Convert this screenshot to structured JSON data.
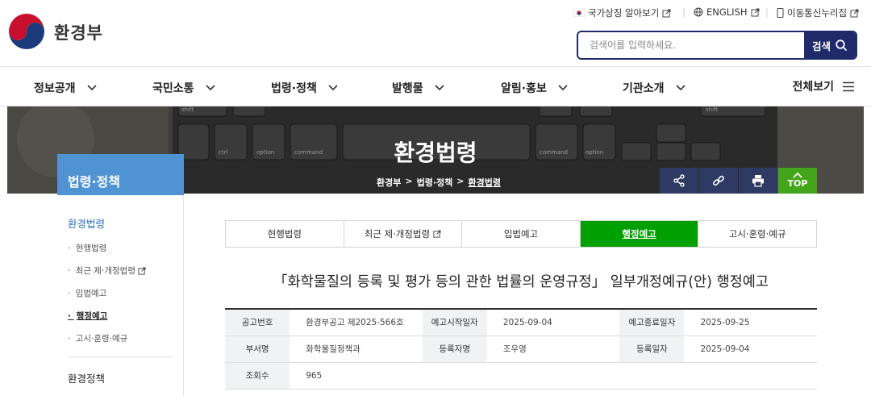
{
  "header": {
    "logo_text": "환경부",
    "util_links": [
      {
        "label": "국가상징 알아보기"
      },
      {
        "label": "ENGLISH"
      },
      {
        "label": "이동통신누리집"
      }
    ],
    "search": {
      "placeholder": "검색어를 입력하세요.",
      "button_label": "검색"
    }
  },
  "gnb": {
    "items": [
      "정보공개",
      "국민소통",
      "법령·정책",
      "발행물",
      "알림·홍보",
      "기관소개"
    ],
    "all_label": "전체보기"
  },
  "visual": {
    "title": "환경법령",
    "breadcrumb": [
      "환경부",
      "법령·정책",
      "환경법령"
    ],
    "breadcrumb_sep": ">",
    "top_label": "TOP"
  },
  "lnb": {
    "title": "법령·정책",
    "categories": [
      {
        "label": "환경법령",
        "active": true
      },
      {
        "label": "환경정책",
        "active": false
      }
    ],
    "sub_items": [
      "현행법령",
      "최근 제·개정법령",
      "입법예고",
      "행정예고",
      "고시·훈령·예규"
    ]
  },
  "tabs": [
    "현행법령",
    "최근 제·개정법령",
    "입법예고",
    "행정예고",
    "고시·훈령·예규"
  ],
  "document": {
    "title": "「화학물질의 등록 및 평가 등의 관한 법률의 운영규정」 일부개정예규(안) 행정예고",
    "info": {
      "r1": [
        "공고번호",
        "환경부공고 제2025-566호",
        "예고시작일자",
        "2025-09-04",
        "예고종료일자",
        "2025-09-25"
      ],
      "r2": [
        "부서명",
        "화학물질정책과",
        "등록자명",
        "조우영",
        "등록일자",
        "2025-09-04"
      ],
      "r3": [
        "조회수",
        "965"
      ]
    }
  },
  "colors": {
    "accent_navy": "#1f2a6b",
    "tab_active": "#00a000",
    "lnb_header": "#4f93d2",
    "top_button": "#43a51b"
  },
  "icons": [
    "flag-icon",
    "globe-icon",
    "external-link-icon",
    "mobile-icon",
    "search-icon",
    "chevron-down-icon",
    "hamburger-icon",
    "share-icon",
    "link-icon",
    "print-icon",
    "arrow-up-icon"
  ]
}
